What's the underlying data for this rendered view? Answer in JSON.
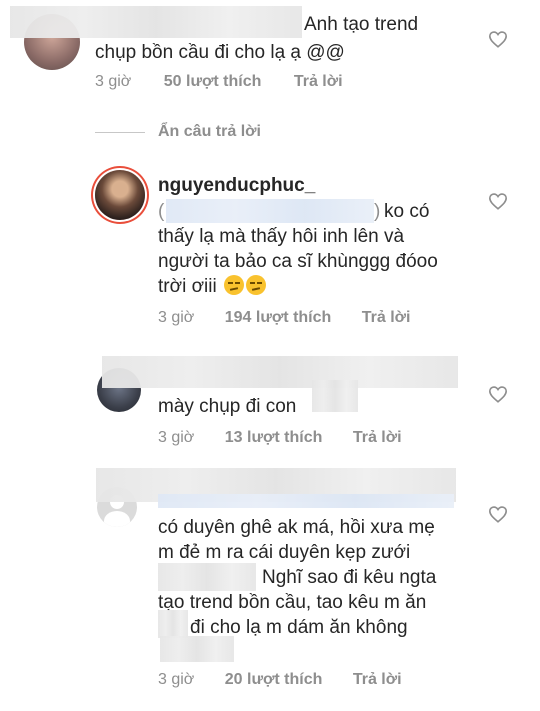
{
  "comments": [
    {
      "text_lines": [
        "Anh tạo trend",
        "chụp bồn cầu đi cho lạ ạ @@"
      ],
      "time": "3 giờ",
      "likes": "50 lượt thích",
      "reply": "Trả lời"
    },
    {
      "username": "nguyenducphuc_",
      "text_lines": [
        "ko có",
        "thấy lạ mà thấy hôi inh lên và",
        "người ta bảo ca sĩ khùnggg đóoo",
        "trời ơiii"
      ],
      "time": "3 giờ",
      "likes": "194 lượt thích",
      "reply": "Trả lời"
    },
    {
      "text_lines": [
        "mày chụp đi con"
      ],
      "time": "3 giờ",
      "likes": "13 lượt thích",
      "reply": "Trả lời"
    },
    {
      "text_lines": [
        "có duyên ghê ak má, hồi xưa mẹ",
        "m đẻ  m ra cái duyên kẹp zưới",
        "Nghĩ sao đi kêu ngta",
        "tạo trend bồn cầu, tao kêu m ăn",
        "đi cho lạ m dám ăn không"
      ],
      "time": "3 giờ",
      "likes": "20 lượt thích",
      "reply": "Trả lời"
    }
  ],
  "hide_replies": "Ẩn câu trả lời",
  "icons": {
    "like": "heart-outline-icon"
  }
}
